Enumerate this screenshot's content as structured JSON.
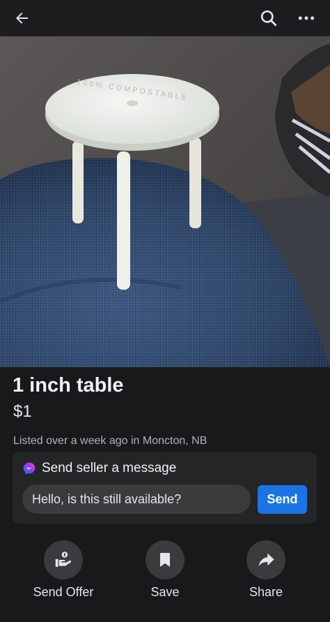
{
  "header": {
    "back_icon": "arrow-left-icon",
    "search_icon": "search-icon",
    "more_icon": "more-dots-icon"
  },
  "listing": {
    "title": "1 inch table",
    "price": "$1",
    "listed_text": "Listed over a week ago in Moncton, NB",
    "photo_table_text": "100% COMPOSTABLE"
  },
  "message_card": {
    "heading": "Send seller a message",
    "icon": "messenger-icon",
    "input_value": "Hello, is this still available?",
    "send_label": "Send",
    "send_color": "#1b74e4"
  },
  "actions": [
    {
      "label": "Send Offer",
      "icon": "offer-hand-icon"
    },
    {
      "label": "Save",
      "icon": "bookmark-icon"
    },
    {
      "label": "Share",
      "icon": "share-arrow-icon"
    }
  ]
}
